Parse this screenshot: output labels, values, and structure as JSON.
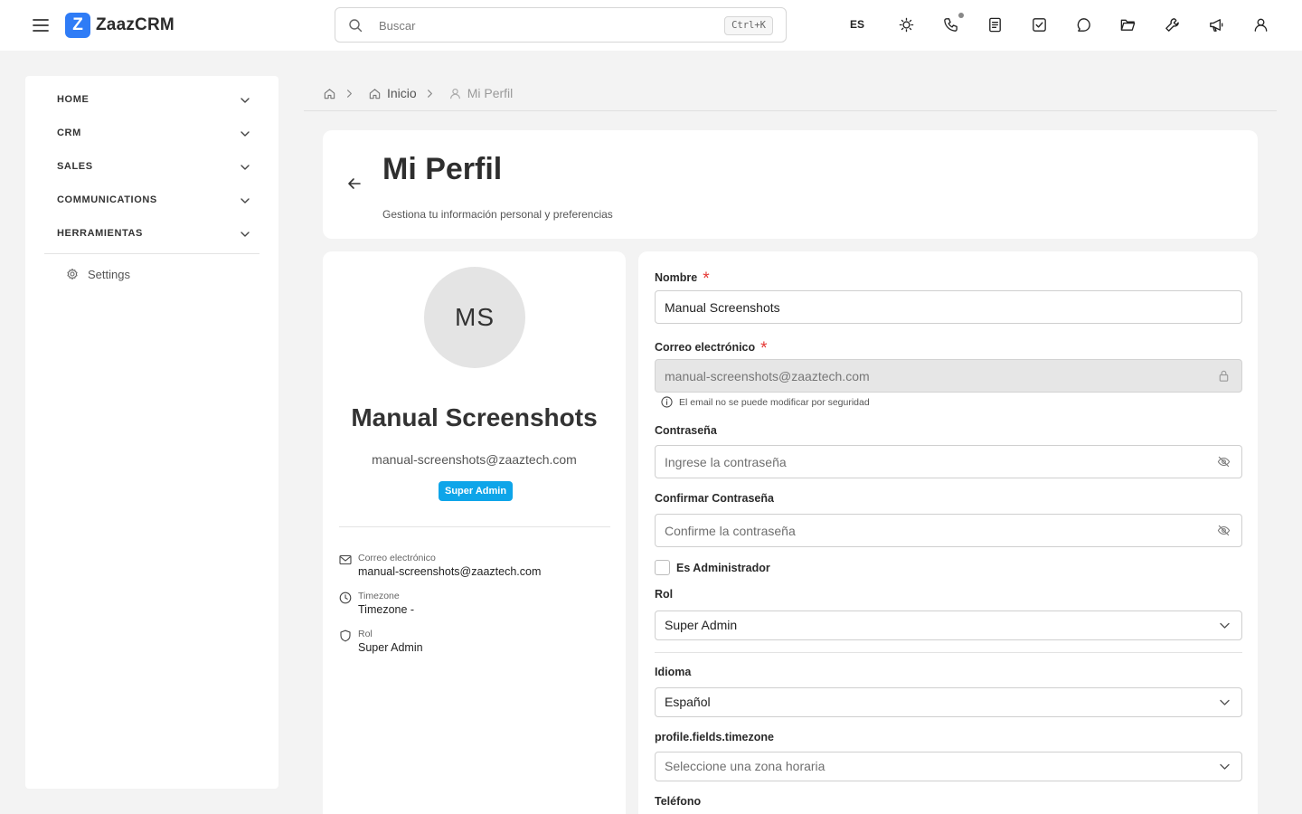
{
  "app": {
    "logo_letter": "Z",
    "name": "ZaazCRM"
  },
  "header": {
    "search_placeholder": "Buscar",
    "search_shortcut": "Ctrl+K",
    "language": "ES",
    "icons": [
      "sun-icon",
      "phone-icon",
      "notes-icon",
      "tasks-icon",
      "chat-icon",
      "folder-icon",
      "wrench-icon",
      "megaphone-icon",
      "user-icon"
    ]
  },
  "sidebar": {
    "items": [
      {
        "label": "HOME"
      },
      {
        "label": "CRM"
      },
      {
        "label": "SALES"
      },
      {
        "label": "COMMUNICATIONS"
      },
      {
        "label": "HERRAMIENTAS"
      }
    ],
    "settings_label": "Settings"
  },
  "breadcrumb": {
    "home_label": "Inicio",
    "current_label": "Mi Perfil"
  },
  "page": {
    "title": "Mi Perfil",
    "subtitle": "Gestiona tu información personal y preferencias"
  },
  "profile": {
    "initials": "MS",
    "name": "Manual Screenshots",
    "email": "manual-screenshots@zaaztech.com",
    "role_badge": "Super Admin",
    "info": {
      "email_label": "Correo electrónico",
      "email_value": "manual-screenshots@zaaztech.com",
      "timezone_label": "Timezone",
      "timezone_value": "Timezone -",
      "role_label": "Rol",
      "role_value": "Super Admin"
    }
  },
  "form": {
    "name_label": "Nombre",
    "name_value": "Manual Screenshots",
    "email_label": "Correo electrónico",
    "email_value": "manual-screenshots@zaaztech.com",
    "email_hint": "El email no se puede modificar por seguridad",
    "password_label": "Contraseña",
    "password_placeholder": "Ingrese la contraseña",
    "confirm_label": "Confirmar Contraseña",
    "confirm_placeholder": "Confirme la contraseña",
    "admin_label": "Es Administrador",
    "admin_checked": false,
    "role_label": "Rol",
    "role_value": "Super Admin",
    "language_label": "Idioma",
    "language_value": "Español",
    "timezone_label": "profile.fields.timezone",
    "timezone_placeholder": "Seleccione una zona horaria",
    "phone_label": "Teléfono",
    "required_mark": "*"
  },
  "colors": {
    "brand": "#2f7cf6",
    "badge": "#0ea5e9",
    "required": "#e53935",
    "background": "#f3f3f3"
  }
}
